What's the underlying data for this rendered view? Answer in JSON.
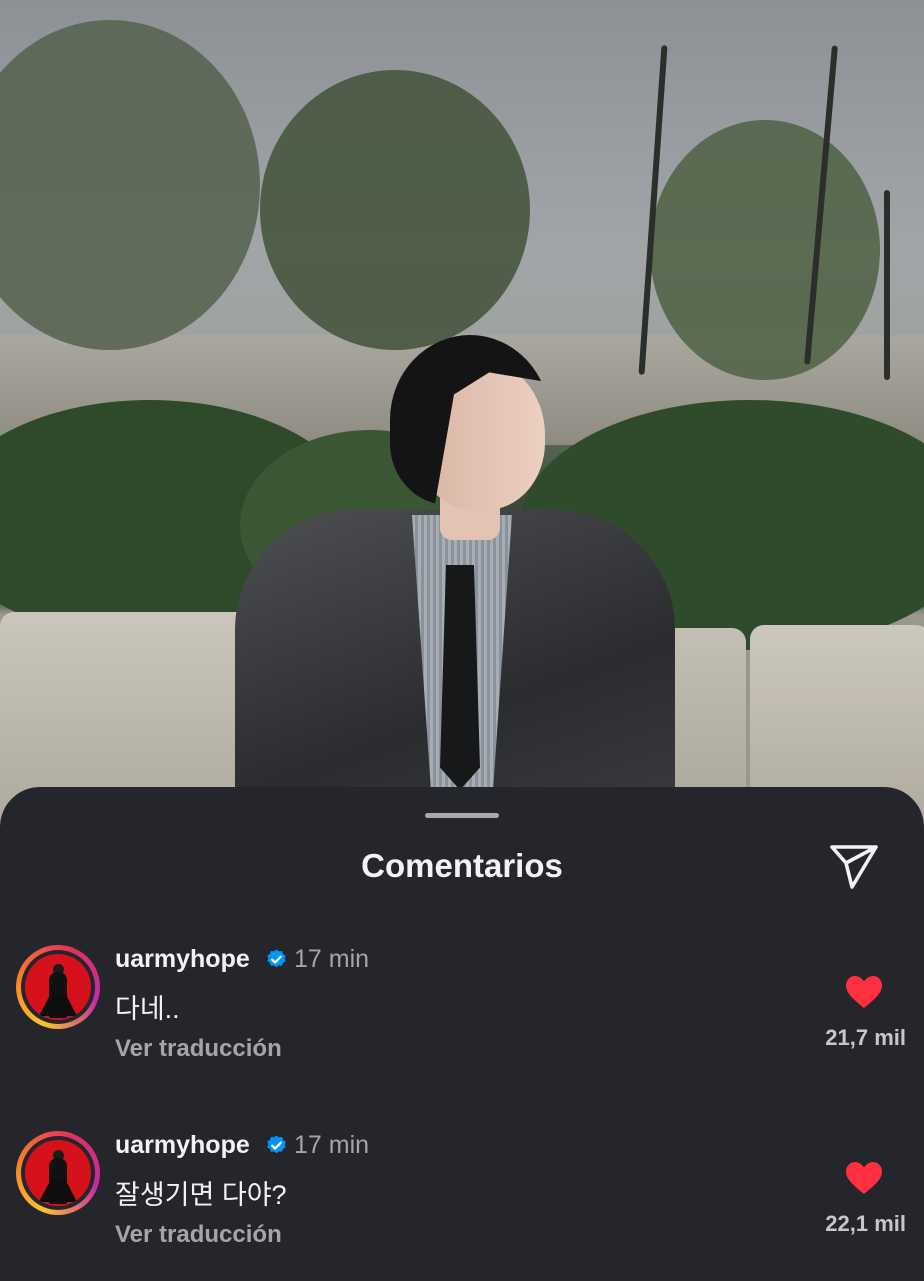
{
  "sheet": {
    "title": "Comentarios",
    "share_icon": "paper-plane-icon"
  },
  "comments": [
    {
      "username": "uarmyhope",
      "verified": true,
      "time": "17 min",
      "text": "다네..",
      "translate_label": "Ver traducción",
      "likes": "21,7 mil",
      "liked": true
    },
    {
      "username": "uarmyhope",
      "verified": true,
      "time": "17 min",
      "text": "잘생기면 다야?",
      "translate_label": "Ver traducción",
      "likes": "22,1 mil",
      "liked": true
    }
  ],
  "colors": {
    "sheet_bg": "#25262b",
    "heart": "#ff3040",
    "verified": "#0095f6",
    "muted_text": "#a4a5aa"
  }
}
